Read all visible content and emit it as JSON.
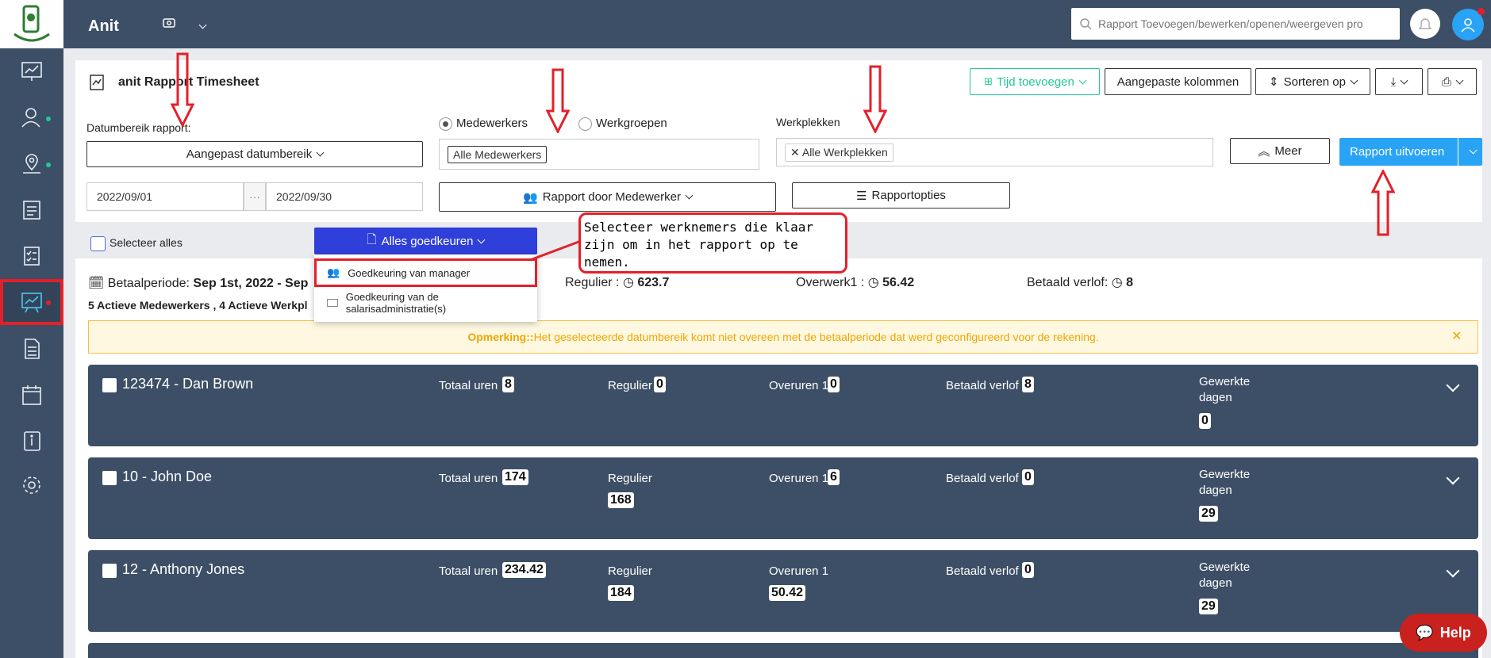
{
  "app": {
    "title": "Anit"
  },
  "search": {
    "placeholder": "Rapport Toevoegen/bewerken/openen/weergeven pro"
  },
  "report": {
    "title": "anit Rapport Timesheet"
  },
  "toolbar": {
    "add_time": "Tijd toevoegen",
    "custom_columns": "Aangepaste kolommen",
    "sort": "Sorteren op"
  },
  "filters": {
    "date_range_label": "Datumbereik rapport:",
    "date_range_value": "Aangepast datumbereik",
    "start_date": "2022/09/01",
    "end_date": "2022/09/30",
    "date_sep": "···",
    "radio_employees": "Medewerkers",
    "radio_groups": "Werkgroepen",
    "employees_chip": "Alle Medewerkers",
    "workplaces_label": "Werkplekken",
    "workplaces_chip": "Alle Werkplekken",
    "more": "Meer",
    "run": "Rapport uitvoeren",
    "report_by": "Rapport door Medewerker",
    "options": "Rapportopties"
  },
  "selection": {
    "select_all": "Selecteer alles",
    "approve_all": "Alles goedkeuren",
    "menu": [
      "Goedkeuring van manager",
      "Goedkeuring van de salarisadministratie(s)"
    ]
  },
  "annotation": {
    "text": "Selecteer werknemers die klaar zijn om in het rapport op te nemen."
  },
  "summary": {
    "pay_period_label": "Betaalperiode:",
    "pay_period_value": "Sep 1st, 2022 - Sep",
    "active": "5 Actieve Medewerkers , 4 Actieve Werkpl",
    "regular_label": "Regulier :",
    "regular_value": "623.7",
    "overtime_label": "Overwerk1 :",
    "overtime_value": "56.42",
    "paid_leave_label": "Betaald verlof:",
    "paid_leave_value": "8"
  },
  "remark": {
    "label": "Opmerking::",
    "text": " Het geselecteerde datumbereik komt niet overeen met de betaalperiode dat werd geconfigureerd voor de rekening."
  },
  "cards": {
    "labels": {
      "total": "Totaal uren",
      "regular": "Regulier",
      "overtime": "Overuren 1",
      "paid_leave": "Betaald verlof",
      "worked_days_1": "Gewerkte",
      "worked_days_2": "dagen"
    },
    "employees": [
      {
        "name": "123474 - Dan Brown",
        "total": "8",
        "regular": "0",
        "overtime": "0",
        "paid_leave": "8",
        "days": "0"
      },
      {
        "name": "10 - John Doe",
        "total": "174",
        "regular": "168",
        "overtime": "6",
        "paid_leave": "0",
        "days": "29"
      },
      {
        "name": "12 - Anthony Jones",
        "total": "234.42",
        "regular": "184",
        "overtime": "50.42",
        "paid_leave": "0",
        "days": "29"
      }
    ]
  },
  "help": {
    "label": "Help"
  },
  "colors": {
    "sidebar": "#3d4f66",
    "primary": "#29a3f5",
    "annotation": "#e3202a",
    "approve": "#2f3fd9"
  }
}
